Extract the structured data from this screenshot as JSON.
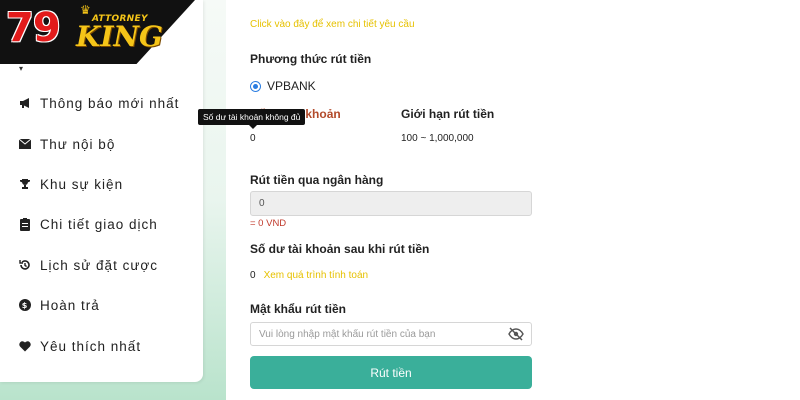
{
  "logo": {
    "number": "79",
    "attorney": "ATTORNEY",
    "king": "KING"
  },
  "sidebar": {
    "items": [
      {
        "label": "Thông báo mới nhất",
        "icon": "megaphone-icon"
      },
      {
        "label": "Thư nội bộ",
        "icon": "envelope-icon"
      },
      {
        "label": "Khu sự kiện",
        "icon": "trophy-icon"
      },
      {
        "label": "Chi tiết giao dịch",
        "icon": "clipboard-icon"
      },
      {
        "label": "Lịch sử đặt cược",
        "icon": "history-icon"
      },
      {
        "label": "Hoàn trả",
        "icon": "dollar-icon"
      },
      {
        "label": "Yêu thích nhất",
        "icon": "heart-icon"
      }
    ]
  },
  "main": {
    "top_link": "Click vào đây để xem chi tiết yêu cầu",
    "method_title": "Phương thức rút tiền",
    "bank_option": "VPBANK",
    "balance_label": "Số dư tài khoản",
    "balance_value": "0",
    "limit_label": "Giới hạn rút tiền",
    "limit_value": "100 ~ 1,000,000",
    "tooltip": "Số dư tài khoản không đủ",
    "bank_withdraw_title": "Rút tiền qua ngân hàng",
    "amount_value": "0",
    "vnd_note": "= 0 VND",
    "after_balance_title": "Số dư tài khoản sau khi rút tiền",
    "after_balance_value": "0",
    "calc_link": "Xem quá trình tính toán",
    "password_title": "Mật khẩu rút tiền",
    "password_placeholder": "Vui lòng nhập mật khẩu rút tiền của bạn",
    "submit_label": "Rút tiền"
  },
  "colors": {
    "accent_teal": "#3aaf9a",
    "link_yellow": "#e6c100",
    "error_red": "#c0392b",
    "logo_red": "#e21b1b",
    "logo_gold": "#f5c518"
  }
}
